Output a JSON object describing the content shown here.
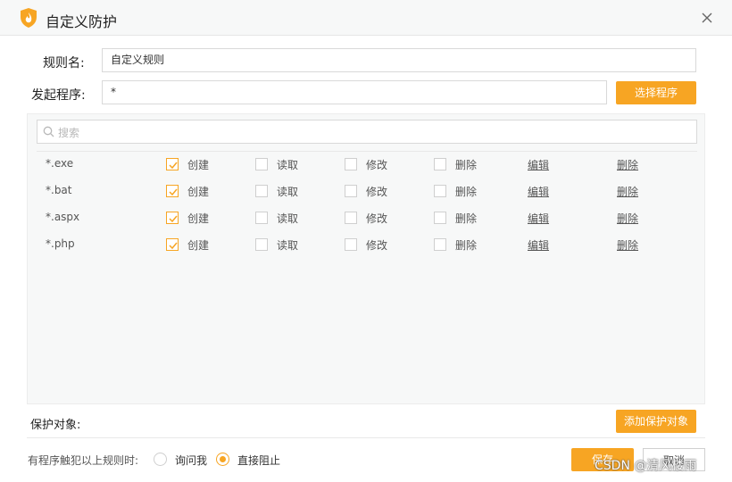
{
  "window": {
    "title": "自定义防护"
  },
  "form": {
    "rule_name_label": "规则名:",
    "rule_name_value": "自定义规则",
    "program_label": "发起程序:",
    "program_value": "*",
    "select_program_button": "选择程序"
  },
  "search": {
    "placeholder": "搜索"
  },
  "rules": [
    {
      "name": "*.exe",
      "create": "创建",
      "create_checked": true,
      "read": "读取",
      "modify": "修改",
      "delete": "删除",
      "edit_link": "编辑",
      "delete_link": "删除"
    },
    {
      "name": "*.bat",
      "create": "创建",
      "create_checked": true,
      "read": "读取",
      "modify": "修改",
      "delete": "删除",
      "edit_link": "编辑",
      "delete_link": "删除"
    },
    {
      "name": "*.aspx",
      "create": "创建",
      "create_checked": true,
      "read": "读取",
      "modify": "修改",
      "delete": "删除",
      "edit_link": "编辑",
      "delete_link": "删除"
    },
    {
      "name": "*.php",
      "create": "创建",
      "create_checked": true,
      "read": "读取",
      "modify": "修改",
      "delete": "删除",
      "edit_link": "编辑",
      "delete_link": "删除"
    }
  ],
  "protect": {
    "label": "保护对象:",
    "add_button": "添加保护对象"
  },
  "footer": {
    "trigger_label": "有程序触犯以上规则时:",
    "option_ask": "询问我",
    "option_block": "直接阻止",
    "selected": "直接阻止",
    "save_button": "保存",
    "cancel_button": "取消"
  },
  "watermark": "CSDN @清风楼雨",
  "colors": {
    "accent": "#f7a523",
    "panel_bg": "#f7f8f8"
  },
  "icons": {
    "logo": "shield-flame-icon",
    "close": "close-icon",
    "search": "search-icon",
    "check": "checkmark-icon"
  }
}
